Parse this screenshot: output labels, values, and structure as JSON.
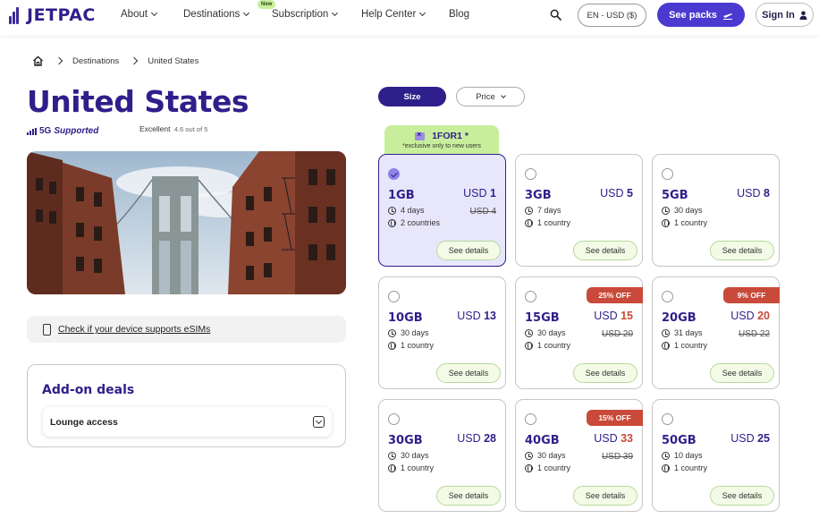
{
  "header": {
    "logo_text": "JETPAC",
    "nav": [
      {
        "label": "About",
        "has_dropdown": true
      },
      {
        "label": "Destinations",
        "has_dropdown": true
      },
      {
        "label": "Subscription",
        "has_dropdown": true
      },
      {
        "label": "Help Center",
        "has_dropdown": true
      },
      {
        "label": "Blog",
        "has_dropdown": false
      }
    ],
    "new_badge": "New",
    "language_currency": "EN - USD ($)",
    "see_packs_label": "See packs",
    "sign_in_label": "Sign In"
  },
  "breadcrumb": {
    "items": [
      "Destinations",
      "United States"
    ]
  },
  "title": "United States",
  "network": {
    "label": "5G",
    "label_suffix": "Supported"
  },
  "rating": {
    "label": "Excellent",
    "score": "4.6 out of 5"
  },
  "device_check": {
    "label": "Check if your device supports eSIMs"
  },
  "addons": {
    "title": "Add-on deals",
    "items": [
      {
        "label": "Lounge access"
      }
    ]
  },
  "filters": {
    "size_label": "Size",
    "price_label": "Price",
    "active": "Size"
  },
  "promo": {
    "code": "1FOR1 *",
    "note": "*exclusive only to new users"
  },
  "packages": [
    {
      "size": "1GB",
      "currency": "USD",
      "price": "1",
      "old_price": "USD 4",
      "days": "4 days",
      "countries": "2 countries",
      "discount": "",
      "selected": true
    },
    {
      "size": "3GB",
      "currency": "USD",
      "price": "5",
      "old_price": "",
      "days": "7 days",
      "countries": "1 country",
      "discount": "",
      "selected": false
    },
    {
      "size": "5GB",
      "currency": "USD",
      "price": "8",
      "old_price": "",
      "days": "30 days",
      "countries": "1 country",
      "discount": "",
      "selected": false
    },
    {
      "size": "10GB",
      "currency": "USD",
      "price": "13",
      "old_price": "",
      "days": "30 days",
      "countries": "1 country",
      "discount": "",
      "selected": false
    },
    {
      "size": "15GB",
      "currency": "USD",
      "price": "15",
      "old_price": "USD 20",
      "days": "30 days",
      "countries": "1 country",
      "discount": "25% OFF",
      "selected": false
    },
    {
      "size": "20GB",
      "currency": "USD",
      "price": "20",
      "old_price": "USD 22",
      "days": "31 days",
      "countries": "1 country",
      "discount": "9% OFF",
      "selected": false
    },
    {
      "size": "30GB",
      "currency": "USD",
      "price": "28",
      "old_price": "",
      "days": "30 days",
      "countries": "1 country",
      "discount": "",
      "selected": false
    },
    {
      "size": "40GB",
      "currency": "USD",
      "price": "33",
      "old_price": "USD 39",
      "days": "30 days",
      "countries": "1 country",
      "discount": "15% OFF",
      "selected": false
    },
    {
      "size": "50GB",
      "currency": "USD",
      "price": "25",
      "old_price": "",
      "days": "10 days",
      "countries": "1 country",
      "discount": "",
      "selected": false
    }
  ],
  "details_label": "See details",
  "colors": {
    "brand": "#2e1f8a",
    "accent": "#4a3ad0",
    "promo": "#c8ee9c",
    "discount": "#c94a3a"
  }
}
